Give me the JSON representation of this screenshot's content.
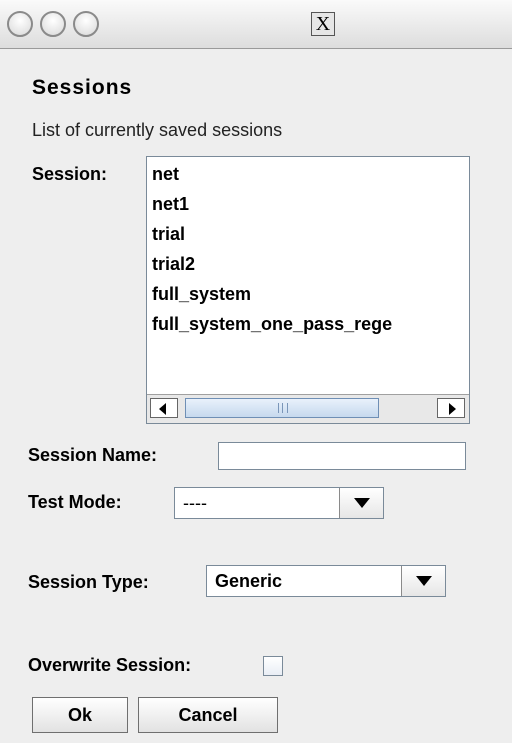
{
  "window": {
    "close_glyph": "X"
  },
  "dialog": {
    "title": "Sessions",
    "subtitle": "List of currently saved sessions",
    "session_label": "Session:",
    "sessions": [
      "net",
      "net1",
      "trial",
      "trial2",
      "full_system",
      "full_system_one_pass_rege"
    ],
    "session_name_label": "Session Name:",
    "session_name_value": "",
    "test_mode_label": "Test Mode:",
    "test_mode_value": "----",
    "session_type_label": "Session Type:",
    "session_type_value": "Generic",
    "overwrite_label": "Overwrite Session:",
    "ok_label": "Ok",
    "cancel_label": "Cancel"
  },
  "icons": {
    "window_buttons": "circle-button-icon",
    "close": "close-icon",
    "scroll_left": "arrow-left-icon",
    "scroll_right": "arrow-right-icon",
    "dropdown": "chevron-down-icon"
  }
}
